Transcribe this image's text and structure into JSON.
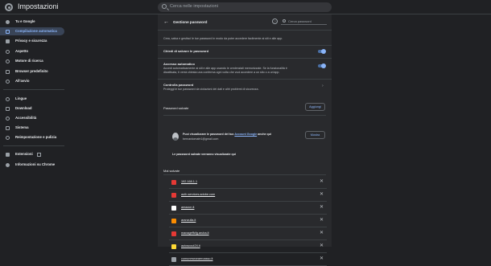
{
  "app": {
    "title": "Impostazioni"
  },
  "search": {
    "placeholder": "Cerca nelle impostazioni"
  },
  "sidebar": {
    "items": [
      {
        "label": "Tu e Google"
      },
      {
        "label": "Compilazione automatica"
      },
      {
        "label": "Privacy e sicurezza"
      },
      {
        "label": "Aspetto"
      },
      {
        "label": "Motore di ricerca"
      },
      {
        "label": "Browser predefinito"
      },
      {
        "label": "All'avvio"
      },
      {
        "label": "Lingue"
      },
      {
        "label": "Download"
      },
      {
        "label": "Accessibilità"
      },
      {
        "label": "Sistema"
      },
      {
        "label": "Reimpostazione e pulizia"
      },
      {
        "label": "Estensioni"
      },
      {
        "label": "Informazioni su Chrome"
      }
    ]
  },
  "panel": {
    "title": "Gestione password",
    "search_placeholder": "Cerca password",
    "intro": "Crea, salva e gestisci le tue password in modo da poter accedere facilmente ai siti e alle app.",
    "offer_save_label": "Chiedi di salvare le password",
    "auto_signin_label": "Accesso automatico",
    "auto_signin_desc_1": "Accedi automaticamente ai siti e alle app usando le credenziali memorizzate. Se la funzionalità è",
    "auto_signin_desc_2": "disattivata, ti verrà chiesta una conferma ogni volta che vuoi accedere a un sito o a un'app.",
    "check_label": "Controlla password",
    "check_desc": "Proteggi le tue password da violazioni dei dati e altri problemi di sicurezza.",
    "saved_heading": "Password salvate",
    "add_button": "Aggiungi",
    "account_text_1": "Puoi visualizzare le password del tuo",
    "account_link": "Account Google",
    "account_text_2": "anche qui",
    "account_email": "bernardomafe1@gmail.com",
    "show_button": "Mostra",
    "empty_text": "Le password salvate verranno visualizzate qui",
    "never_saved_heading": "Mai salvate",
    "never_saved_sites": [
      {
        "name": "192.168.1.1",
        "color": "#e53935"
      },
      {
        "name": "auth.services.adobe.com",
        "color": "#e53935"
      },
      {
        "name": "amazon.it",
        "color": "#ffffff"
      },
      {
        "name": "aranzulla.it",
        "color": "#fb8c00"
      },
      {
        "name": "manageffcfg.aruba.it",
        "color": "#e53935"
      },
      {
        "name": "autoscout24.it",
        "color": "#fdd835"
      },
      {
        "name": "comunesearaeroasso.it",
        "color": "#9aa0a6"
      }
    ]
  }
}
